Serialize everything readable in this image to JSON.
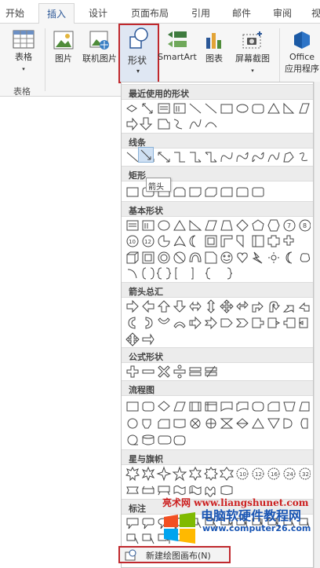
{
  "tabs": [
    {
      "label": "开始"
    },
    {
      "label": "插入"
    },
    {
      "label": "设计"
    },
    {
      "label": "页面布局"
    },
    {
      "label": "引用"
    },
    {
      "label": "邮件"
    },
    {
      "label": "审阅"
    },
    {
      "label": "视"
    }
  ],
  "ribbon": {
    "table_label": "表格",
    "table_group": "表格",
    "picture_label": "图片",
    "online_picture_label": "联机图片",
    "shapes_label": "形状",
    "smartart_label": "SmartArt",
    "chart_label": "图表",
    "screenshot_label": "屏幕截图",
    "office_line1": "Office",
    "office_line2": "应用程序"
  },
  "gallery": {
    "sections": {
      "recent": "最近使用的形状",
      "lines": "线条",
      "rect": "矩形",
      "basic": "基本形状",
      "arrows": "箭头总汇",
      "equation": "公式形状",
      "flowchart": "流程图",
      "stars": "星与旗帜",
      "callouts": "标注"
    },
    "tooltip": "箭头",
    "new_canvas": "新建绘图画布(N)"
  },
  "watermark": {
    "line1": "亮术网 www.liangshunet.com",
    "line2": "电脑软硬件教程网",
    "line3": "www.computer26.com"
  },
  "colors": {
    "accent": "#2b5797",
    "highlight": "#c0282d"
  }
}
